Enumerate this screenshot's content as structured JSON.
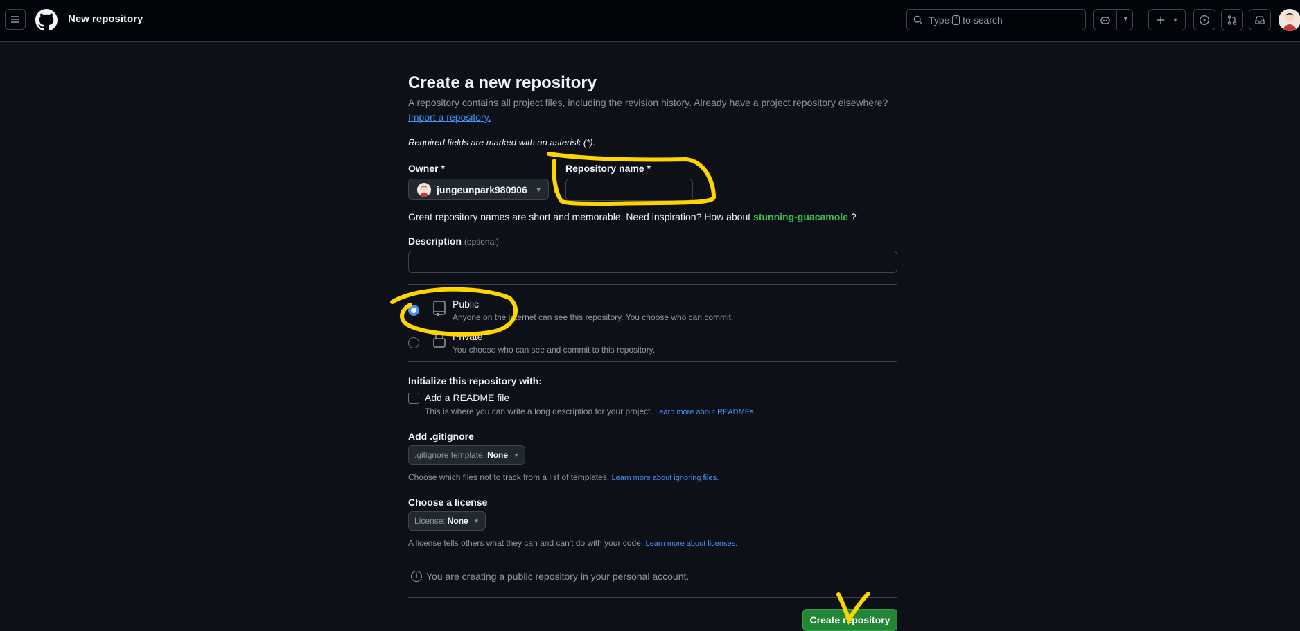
{
  "header": {
    "page_context": "New repository",
    "search_prefix": "Type",
    "search_key": "/",
    "search_suffix": "to search"
  },
  "main": {
    "title": "Create a new repository",
    "subtitle": "A repository contains all project files, including the revision history. Already have a project repository elsewhere?",
    "import_link": "Import a repository.",
    "required_note": "Required fields are marked with an asterisk (*).",
    "owner_label": "Owner *",
    "owner_value": "jungeunpark980906",
    "slash": "/",
    "repo_name_label": "Repository name *",
    "repo_name_value": "",
    "suggest_prefix": "Great repository names are short and memorable. Need inspiration? How about",
    "suggest_name": "stunning-guacamole",
    "suggest_suffix": "?",
    "description_label": "Description",
    "description_optional": "(optional)",
    "description_value": "",
    "visibility": {
      "public_title": "Public",
      "public_desc": "Anyone on the internet can see this repository. You choose who can commit.",
      "private_title": "Private",
      "private_desc": "You choose who can see and commit to this repository.",
      "selected": "Public"
    },
    "init_label": "Initialize this repository with:",
    "readme_label": "Add a README file",
    "readme_desc": "This is where you can write a long description for your project.",
    "readme_link": "Learn more about READMEs.",
    "gitignore_label": "Add .gitignore",
    "gitignore_btn_prefix": ".gitignore template:",
    "gitignore_btn_value": "None",
    "gitignore_desc": "Choose which files not to track from a list of templates.",
    "gitignore_link": "Learn more about ignoring files.",
    "license_label": "Choose a license",
    "license_btn_prefix": "License:",
    "license_btn_value": "None",
    "license_desc": "A license tells others what they can and can't do with your code.",
    "license_link": "Learn more about licenses.",
    "notice": "You are creating a public repository in your personal account.",
    "create_button": "Create repository"
  },
  "colors": {
    "background": "#0d1117",
    "header_bg": "#010409",
    "accent_link": "#4493f8",
    "create_green": "#238636",
    "suggest_green": "#3fb950",
    "annotation_yellow": "#ffd500"
  }
}
